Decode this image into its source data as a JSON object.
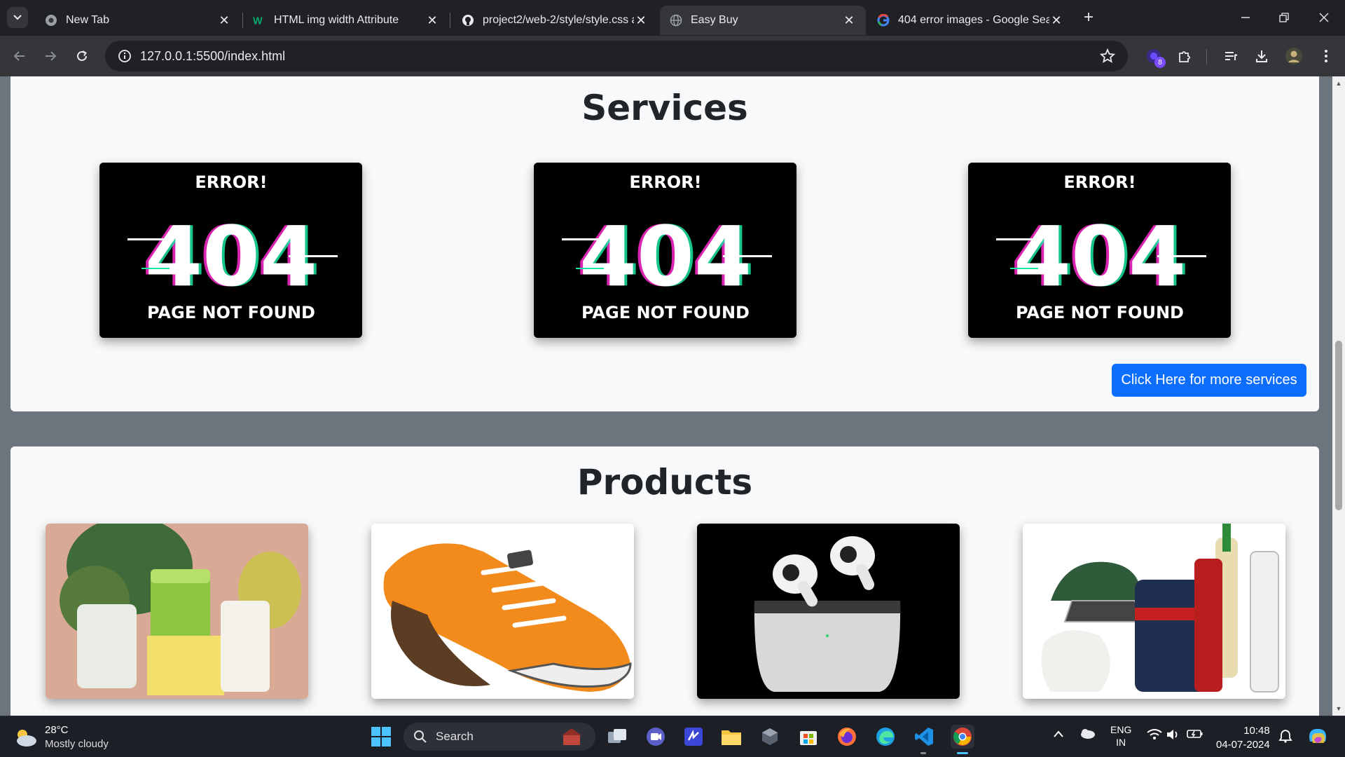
{
  "browser": {
    "tabs": [
      {
        "title": "New Tab",
        "icon": "chrome-icon",
        "active": false
      },
      {
        "title": "HTML img width Attribute",
        "icon": "w3schools-icon",
        "active": false
      },
      {
        "title": "project2/web-2/style/style.css a",
        "icon": "github-icon",
        "active": false
      },
      {
        "title": "Easy Buy",
        "icon": "globe-icon",
        "active": true
      },
      {
        "title": "404 error images - Google Sear",
        "icon": "google-icon",
        "active": false
      }
    ],
    "url": "127.0.0.1:5500/index.html",
    "extension_badge": "8"
  },
  "page": {
    "services": {
      "title": "Services",
      "cards": [
        {
          "top": "ERROR!",
          "big": "404",
          "bottom": "PAGE NOT FOUND"
        },
        {
          "top": "ERROR!",
          "big": "404",
          "bottom": "PAGE NOT FOUND"
        },
        {
          "top": "ERROR!",
          "big": "404",
          "bottom": "PAGE NOT FOUND"
        }
      ],
      "button_label": "Click Here for more services"
    },
    "products": {
      "title": "Products",
      "items": [
        {
          "image": "skincare-products-image"
        },
        {
          "image": "orange-sneaker-image"
        },
        {
          "image": "airpods-pro-image"
        },
        {
          "image": "cricket-kit-image"
        }
      ]
    }
  },
  "taskbar": {
    "weather_temp": "28°C",
    "weather_cond": "Mostly cloudy",
    "search_label": "Search",
    "lang_top": "ENG",
    "lang_bottom": "IN",
    "time": "10:48",
    "date": "04-07-2024"
  },
  "colors": {
    "accent_button": "#0d6efd",
    "page_background": "#6c757d",
    "card_background": "#f8f9fa"
  }
}
